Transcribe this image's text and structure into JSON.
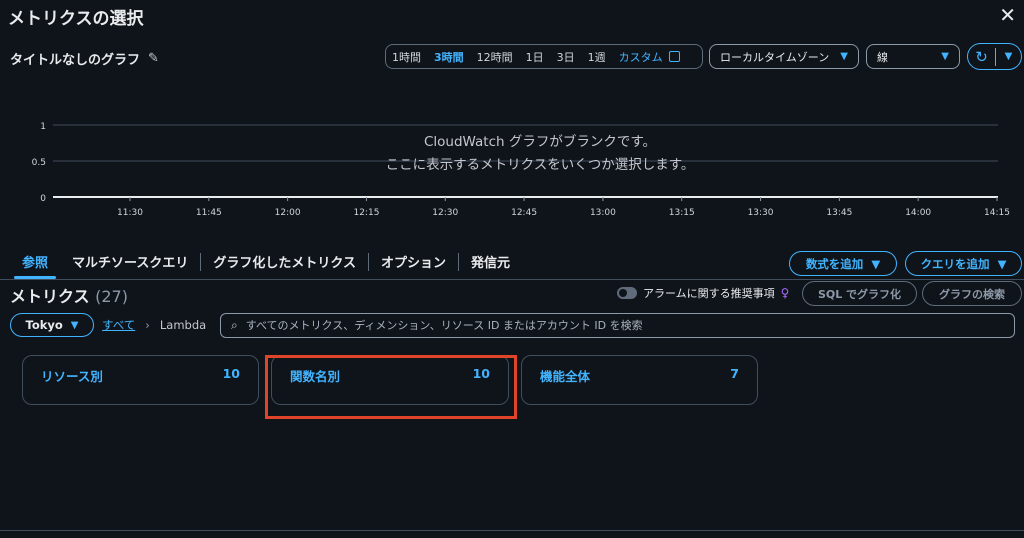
{
  "dialog": {
    "title": "メトリクスの選択",
    "close": "✕"
  },
  "graph": {
    "title": "タイトルなしのグラフ"
  },
  "time_range": {
    "options": [
      "1時間",
      "3時間",
      "12時間",
      "1日",
      "3日",
      "1週"
    ],
    "active": "3時間",
    "custom": "カスタム"
  },
  "timezone": {
    "value": "ローカルタイムゾーン"
  },
  "graph_type": {
    "value": "線"
  },
  "refresh": {
    "icon": "↻",
    "menu": "▼"
  },
  "empty": {
    "line1": "CloudWatch グラフがブランクです。",
    "line2": "ここに表示するメトリクスをいくつか選択します。"
  },
  "chart_data": {
    "type": "line",
    "series": [],
    "y_ticks": [
      "1",
      "0.5",
      "0"
    ],
    "x_ticks": [
      "11:30",
      "11:45",
      "12:00",
      "12:15",
      "12:30",
      "12:45",
      "13:00",
      "13:15",
      "13:30",
      "13:45",
      "14:00",
      "14:15"
    ],
    "ylim": [
      0,
      1
    ]
  },
  "tabs": [
    {
      "label": "参照",
      "active": true
    },
    {
      "label": "マルチソースクエリ",
      "active": false
    },
    {
      "label": "グラフ化したメトリクス",
      "active": false
    },
    {
      "label": "オプション",
      "active": false
    },
    {
      "label": "発信元",
      "active": false
    }
  ],
  "buttons": {
    "add_math": "数式を追加",
    "add_query": "クエリを追加",
    "sql": "SQL でグラフ化",
    "browse": "グラフの検索"
  },
  "metrics": {
    "heading": "メトリクス",
    "count": "(27)"
  },
  "alarm_toggle": {
    "label": "アラームに関する推奨事項"
  },
  "region": {
    "value": "Tokyo"
  },
  "breadcrumb": {
    "all": "すべて",
    "current": "Lambda"
  },
  "search": {
    "placeholder": "すべてのメトリクス、ディメンション、リソース ID またはアカウント ID を検索"
  },
  "cards": [
    {
      "label": "リソース別",
      "count": "10"
    },
    {
      "label": "関数名別",
      "count": "10"
    },
    {
      "label": "機能全体",
      "count": "7"
    }
  ],
  "colors": {
    "accent": "#42b4ff",
    "highlight": "#e0452a",
    "background": "#0f141a"
  }
}
